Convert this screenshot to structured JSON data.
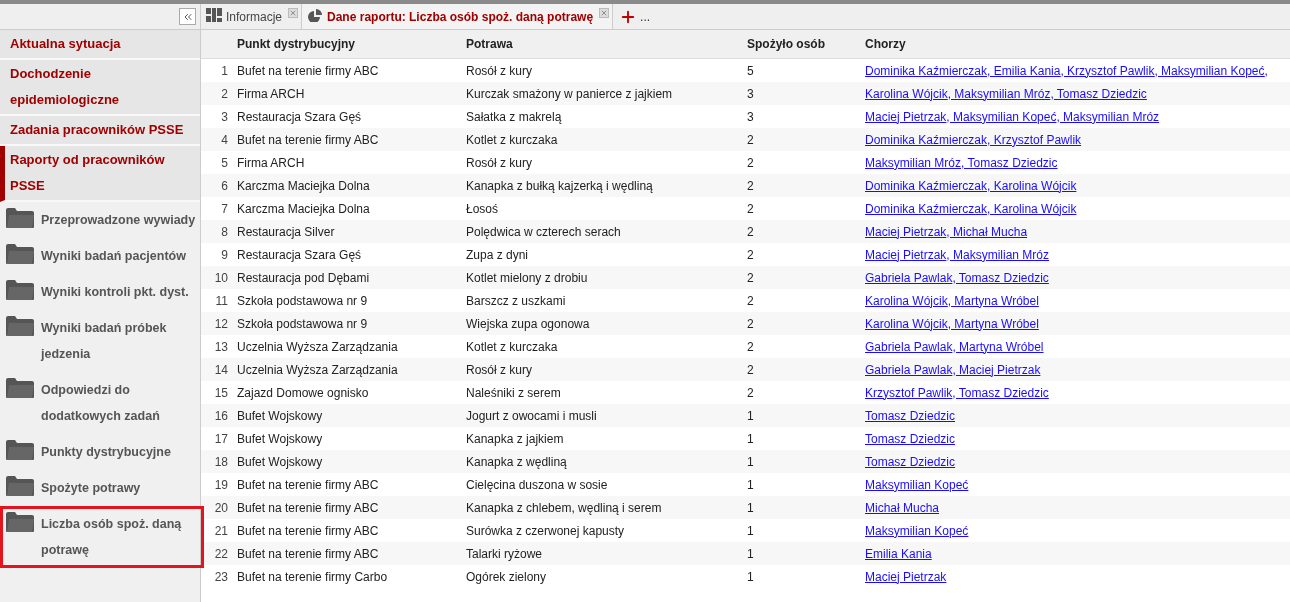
{
  "sidebar": {
    "sections": [
      {
        "label": "Aktualna sytuacja",
        "selected": false
      },
      {
        "label": "Dochodzenie epidemiologiczne",
        "selected": false
      },
      {
        "label": "Zadania pracowników PSSE",
        "selected": false
      },
      {
        "label": "Raporty od pracowników PSSE",
        "selected": true
      }
    ],
    "folders": [
      {
        "label": "Przeprowadzone wywiady",
        "highlighted": false
      },
      {
        "label": "Wyniki badań pacjentów",
        "highlighted": false
      },
      {
        "label": "Wyniki kontroli pkt. dyst.",
        "highlighted": false
      },
      {
        "label": "Wyniki badań próbek jedzenia",
        "highlighted": false
      },
      {
        "label": "Odpowiedzi do dodatkowych zadań",
        "highlighted": false
      },
      {
        "label": "Punkty dystrybucyjne",
        "highlighted": false
      },
      {
        "label": "Spożyte potrawy",
        "highlighted": false
      },
      {
        "label": "Liczba osób spoż. daną potrawę",
        "highlighted": true
      }
    ]
  },
  "tabs": [
    {
      "label": "Informacje",
      "kind": "grid",
      "selected": false
    },
    {
      "label": "Dane raportu: Liczba osób spoż. daną potrawę",
      "kind": "chart",
      "selected": true
    }
  ],
  "more_tabs": "...",
  "table": {
    "columns": [
      "Punkt dystrybucyjny",
      "Potrawa",
      "Spożyło osób",
      "Chorzy"
    ],
    "rows": [
      {
        "n": "1",
        "place": "Bufet na terenie firmy ABC",
        "dish": "Rosół z kury",
        "count": "5",
        "sick": [
          "Dominika Kaźmierczak",
          ", Emilia Kania",
          ", Krzysztof Pawlik",
          ", Maksymilian Kopeć",
          ","
        ]
      },
      {
        "n": "2",
        "place": "Firma ARCH",
        "dish": "Kurczak smażony w panierce z jajkiem",
        "count": "3",
        "sick": [
          "Karolina Wójcik",
          ", Maksymilian Mróz",
          ", Tomasz Dziedzic"
        ]
      },
      {
        "n": "3",
        "place": "Restauracja Szara Gęś",
        "dish": "Sałatka z makrelą",
        "count": "3",
        "sick": [
          "Maciej Pietrzak",
          ", Maksymilian Kopeć",
          ", Maksymilian Mróz"
        ]
      },
      {
        "n": "4",
        "place": "Bufet na terenie firmy ABC",
        "dish": "Kotlet z kurczaka",
        "count": "2",
        "sick": [
          "Dominika Kaźmierczak",
          ", Krzysztof Pawlik"
        ]
      },
      {
        "n": "5",
        "place": "Firma ARCH",
        "dish": "Rosół z kury",
        "count": "2",
        "sick": [
          "Maksymilian Mróz",
          ", Tomasz Dziedzic"
        ]
      },
      {
        "n": "6",
        "place": "Karczma Maciejka Dolna",
        "dish": "Kanapka z bułką kajzerką i wędliną",
        "count": "2",
        "sick": [
          "Dominika Kaźmierczak",
          ", Karolina Wójcik"
        ]
      },
      {
        "n": "7",
        "place": "Karczma Maciejka Dolna",
        "dish": "Łosoś",
        "count": "2",
        "sick": [
          "Dominika Kaźmierczak",
          ", Karolina Wójcik"
        ]
      },
      {
        "n": "8",
        "place": "Restauracja Silver",
        "dish": "Polędwica w czterech serach",
        "count": "2",
        "sick": [
          "Maciej Pietrzak",
          ", Michał Mucha"
        ]
      },
      {
        "n": "9",
        "place": "Restauracja Szara Gęś",
        "dish": "Zupa z dyni",
        "count": "2",
        "sick": [
          "Maciej Pietrzak",
          ", Maksymilian Mróz"
        ]
      },
      {
        "n": "10",
        "place": "Restauracja pod Dębami",
        "dish": "Kotlet mielony z drobiu",
        "count": "2",
        "sick": [
          "Gabriela Pawlak",
          ", Tomasz Dziedzic"
        ]
      },
      {
        "n": "11",
        "place": "Szkoła podstawowa nr 9",
        "dish": "Barszcz z uszkami",
        "count": "2",
        "sick": [
          "Karolina Wójcik",
          ", Martyna Wróbel"
        ]
      },
      {
        "n": "12",
        "place": "Szkoła podstawowa nr 9",
        "dish": "Wiejska zupa ogonowa",
        "count": "2",
        "sick": [
          "Karolina Wójcik",
          ", Martyna Wróbel"
        ]
      },
      {
        "n": "13",
        "place": "Uczelnia Wyższa Zarządzania",
        "dish": "Kotlet z kurczaka",
        "count": "2",
        "sick": [
          "Gabriela Pawlak",
          ", Martyna Wróbel"
        ]
      },
      {
        "n": "14",
        "place": "Uczelnia Wyższa Zarządzania",
        "dish": "Rosół z kury",
        "count": "2",
        "sick": [
          "Gabriela Pawlak",
          ", Maciej Pietrzak"
        ]
      },
      {
        "n": "15",
        "place": "Zajazd Domowe ognisko",
        "dish": "Naleśniki z serem",
        "count": "2",
        "sick": [
          "Krzysztof Pawlik",
          ", Tomasz Dziedzic"
        ]
      },
      {
        "n": "16",
        "place": "Bufet Wojskowy",
        "dish": "Jogurt z owocami i musli",
        "count": "1",
        "sick": [
          "Tomasz Dziedzic"
        ]
      },
      {
        "n": "17",
        "place": "Bufet Wojskowy",
        "dish": "Kanapka z jajkiem",
        "count": "1",
        "sick": [
          "Tomasz Dziedzic"
        ]
      },
      {
        "n": "18",
        "place": "Bufet Wojskowy",
        "dish": "Kanapka z wędliną",
        "count": "1",
        "sick": [
          "Tomasz Dziedzic"
        ]
      },
      {
        "n": "19",
        "place": "Bufet na terenie firmy ABC",
        "dish": "Cielęcina duszona w sosie",
        "count": "1",
        "sick": [
          "Maksymilian Kopeć"
        ]
      },
      {
        "n": "20",
        "place": "Bufet na terenie firmy ABC",
        "dish": "Kanapka z chlebem, wędliną i serem",
        "count": "1",
        "sick": [
          "Michał Mucha"
        ]
      },
      {
        "n": "21",
        "place": "Bufet na terenie firmy ABC",
        "dish": "Surówka z czerwonej kapusty",
        "count": "1",
        "sick": [
          "Maksymilian Kopeć"
        ]
      },
      {
        "n": "22",
        "place": "Bufet na terenie firmy ABC",
        "dish": "Talarki ryżowe",
        "count": "1",
        "sick": [
          "Emilia Kania"
        ]
      },
      {
        "n": "23",
        "place": "Bufet na terenie firmy Carbo",
        "dish": "Ogórek zielony",
        "count": "1",
        "sick": [
          "Maciej Pietrzak"
        ]
      }
    ]
  }
}
